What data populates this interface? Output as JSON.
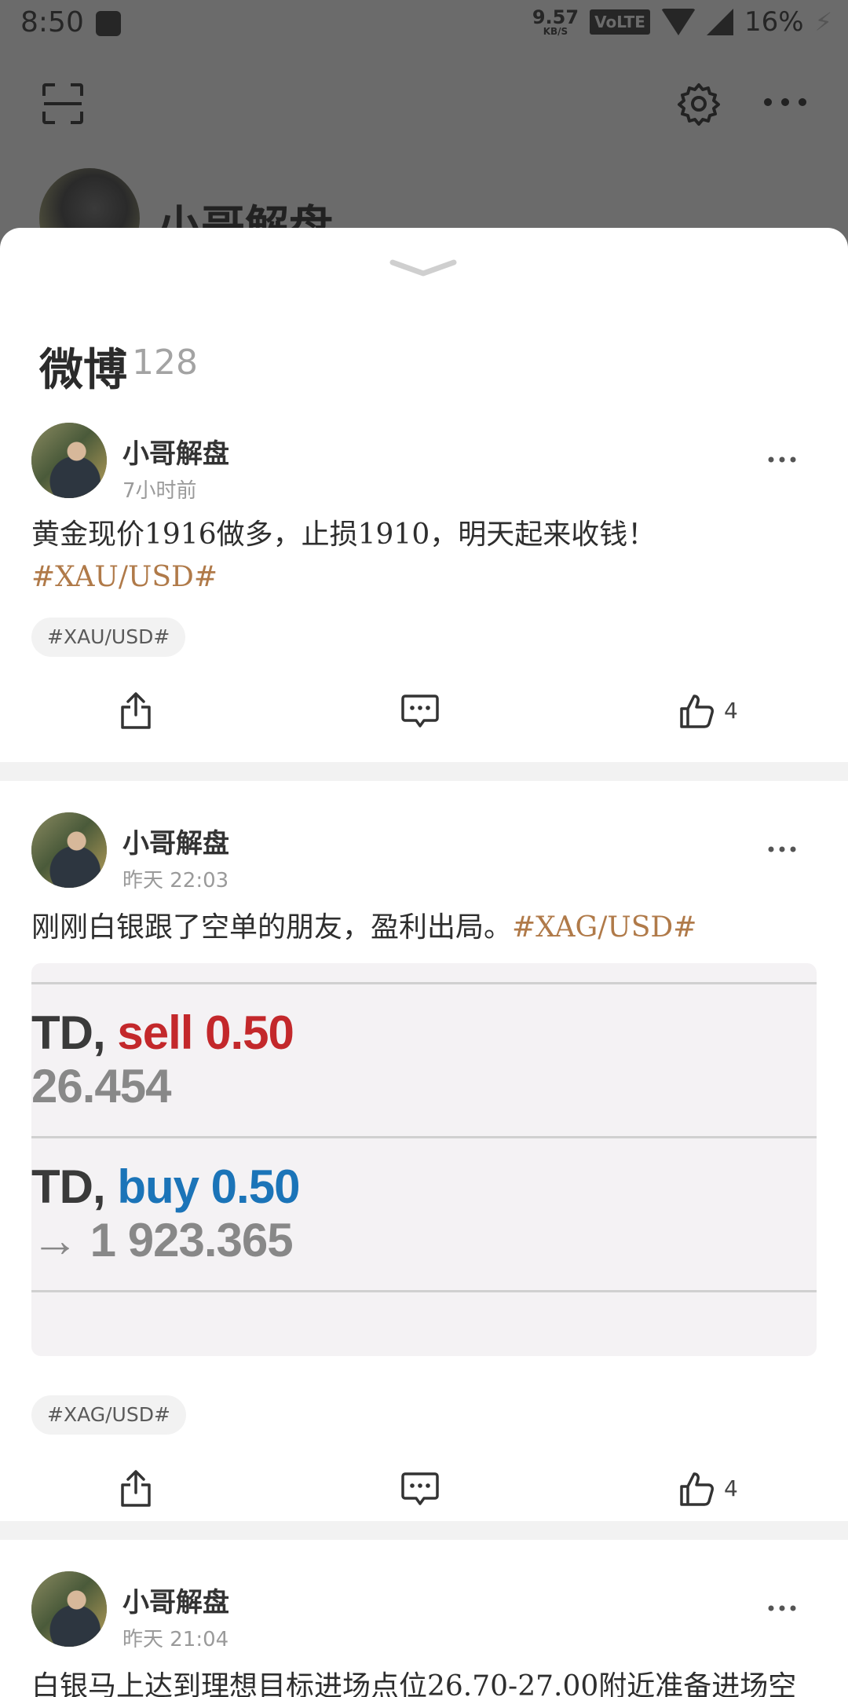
{
  "status_bar": {
    "time": "8:50",
    "net_speed": "9.57",
    "net_unit": "KB/S",
    "volte": "VoLTE",
    "battery": "16%"
  },
  "background": {
    "profile_name": "小哥解盘"
  },
  "sheet": {
    "title": "微博",
    "count": "128"
  },
  "posts": [
    {
      "author": "小哥解盘",
      "time": "7小时前",
      "text": "黄金现价1916做多，止损1910，明天起来收钱！",
      "text_tag": "#XAU/USD#",
      "chip": "#XAU/USD#",
      "likes": "4"
    },
    {
      "author": "小哥解盘",
      "time": "昨天 22:03",
      "text": "刚刚白银跟了空单的朋友，盈利出局。",
      "text_tag": "#XAG/USD#",
      "image": {
        "line1_prefix": "TD,",
        "line1_action": "sell 0.50",
        "line1_price": "26.454",
        "line2_prefix": "TD,",
        "line2_action": "buy 0.50",
        "line2_price": "→ 1 923.365"
      },
      "chip": "#XAG/USD#",
      "likes": "4"
    },
    {
      "author": "小哥解盘",
      "time": "昨天 21:04",
      "text": "白银马上达到理想目标进场点位26.70-27.00附近准备进场空"
    }
  ],
  "icons": {
    "scan": "scan-icon",
    "settings": "gear-icon",
    "more": "more-icon",
    "share": "share-icon",
    "comment": "comment-icon",
    "like": "thumbs-up-icon",
    "collapse": "chevron-down-icon"
  },
  "colors": {
    "hashtag": "#b07a49",
    "sell": "#c3282b",
    "buy": "#1b74b8"
  }
}
